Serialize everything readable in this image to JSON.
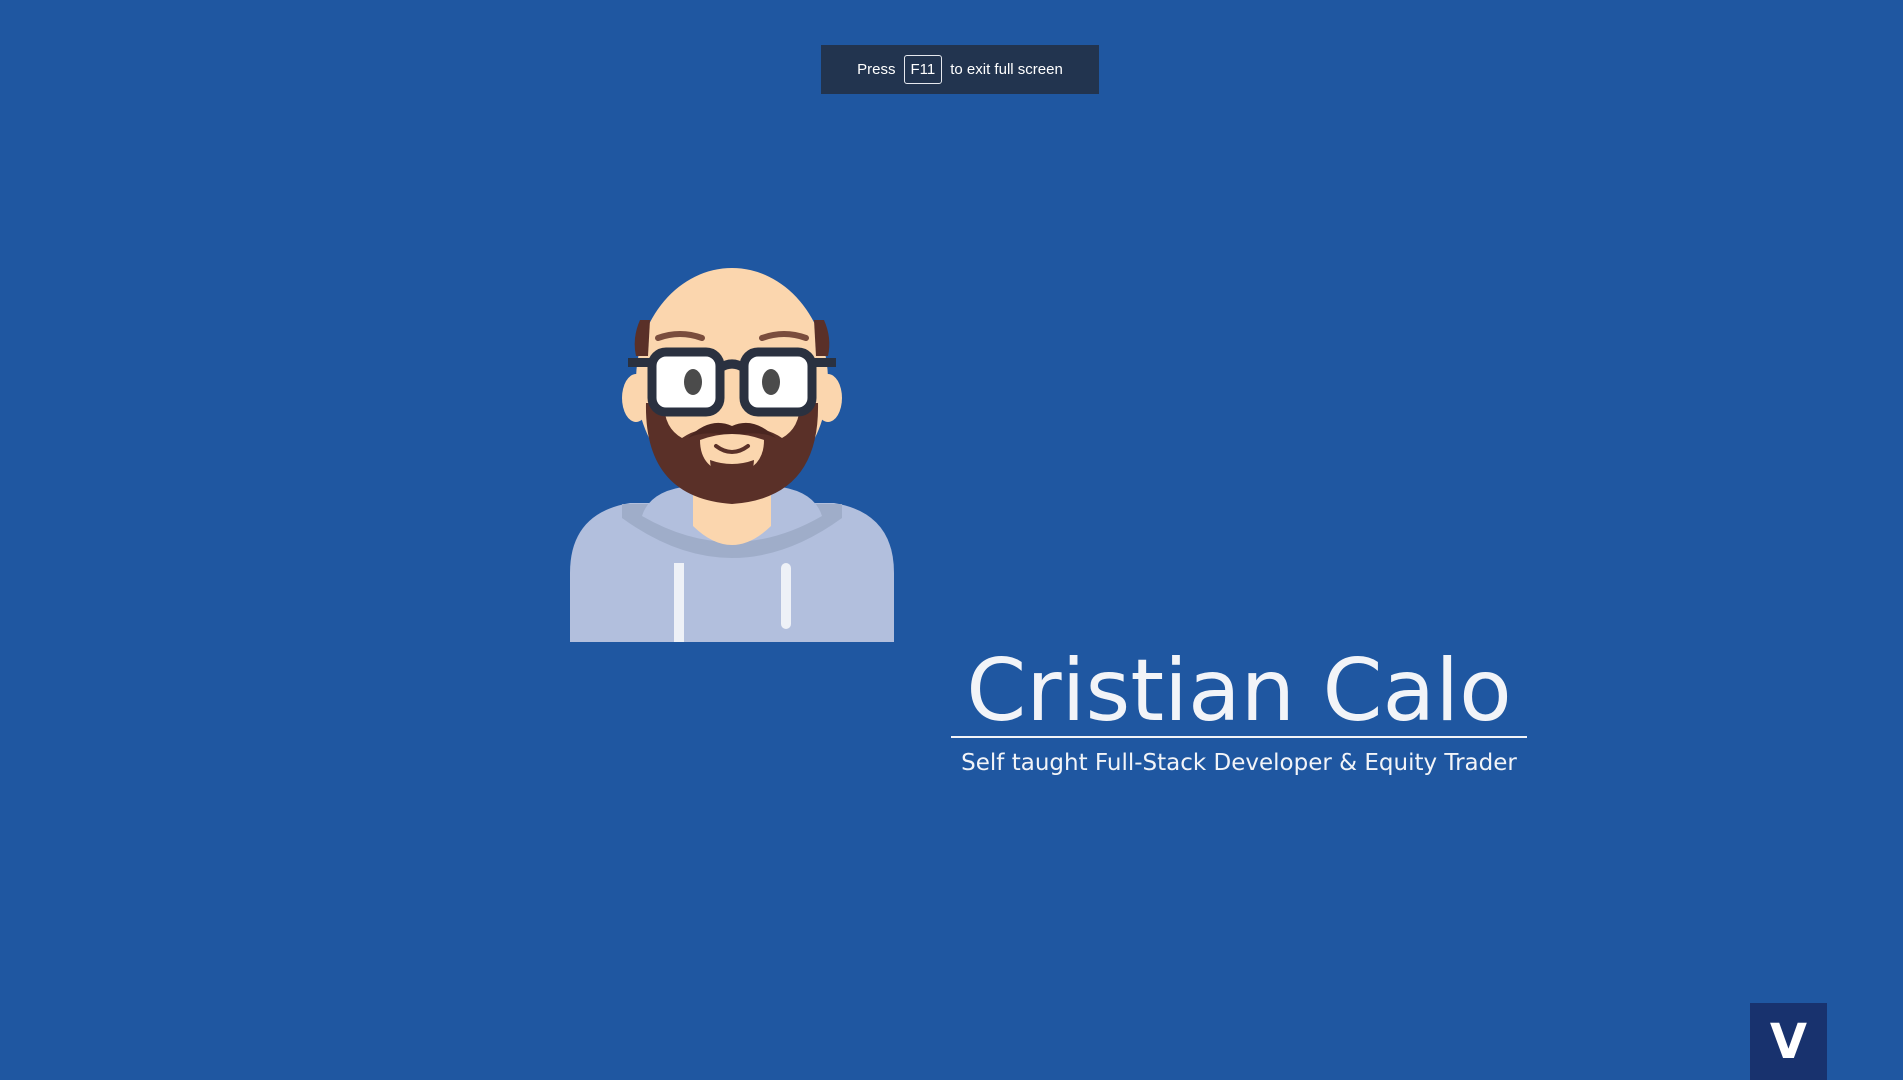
{
  "fullscreen_hint": {
    "prefix": "Press",
    "key": "F11",
    "suffix": "to exit full screen"
  },
  "profile": {
    "name": "Cristian Calo",
    "tagline": "Self taught Full-Stack Developer & Equity Trader"
  },
  "corner_badge": {
    "label": "V"
  },
  "colors": {
    "background": "#1f57a1",
    "toast": "#22344f",
    "badge": "#18326e",
    "text": "#f2f4f8"
  },
  "icons": {
    "avatar": "bald-bearded-man-with-glasses-avatar"
  }
}
